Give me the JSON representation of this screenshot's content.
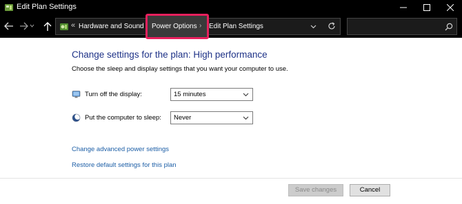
{
  "window": {
    "title": "Edit Plan Settings",
    "icon": "control-panel-icon",
    "controls": [
      "minimize-icon",
      "maximize-icon",
      "close-icon"
    ]
  },
  "navigation": {
    "back_icon": "arrow-left-icon",
    "forward_icon": "arrow-right-icon",
    "up_icon": "arrow-up-icon"
  },
  "address_bar": {
    "overflow": "«",
    "crumbs": [
      "Hardware and Sound",
      "Power Options",
      "Edit Plan Settings"
    ],
    "separator": "›",
    "highlight_color": "#e8205d"
  },
  "search": {
    "placeholder": ""
  },
  "content": {
    "heading": "Change settings for the plan: High performance",
    "subtitle": "Choose the sleep and display settings that you want your computer to use.",
    "settings": [
      {
        "label": "Turn off the display:",
        "value": "15 minutes",
        "icon": "monitor-icon"
      },
      {
        "label": "Put the computer to sleep:",
        "value": "Never",
        "icon": "moon-icon"
      }
    ],
    "links": {
      "advanced": "Change advanced power settings",
      "restore": "Restore default settings for this plan"
    }
  },
  "buttons": {
    "save": "Save changes",
    "cancel": "Cancel"
  },
  "colors": {
    "heading": "#1e3287",
    "link": "#1c5ea6",
    "titlebar": "#000000"
  }
}
